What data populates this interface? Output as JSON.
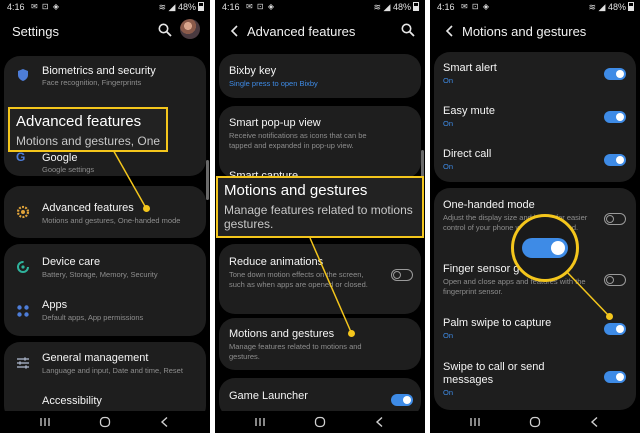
{
  "status": {
    "time": "4:16",
    "battery": "48%"
  },
  "screen1": {
    "title": "Settings",
    "items": [
      {
        "title": "Biometrics and security",
        "sub": "Face recognition, Fingerprints"
      },
      {
        "title": "Google",
        "sub": "Google settings"
      },
      {
        "title": "Advanced features",
        "sub": "Motions and gestures, One-handed mode"
      },
      {
        "title": "Device care",
        "sub": "Battery, Storage, Memory, Security"
      },
      {
        "title": "Apps",
        "sub": "Default apps, App permissions"
      },
      {
        "title": "General management",
        "sub": "Language and input, Date and time, Reset"
      },
      {
        "title": "Accessibility",
        "sub": ""
      }
    ],
    "callout": {
      "title": "Advanced features",
      "sub": "Motions and gestures, One"
    }
  },
  "screen2": {
    "title": "Advanced features",
    "items": [
      {
        "title": "Bixby key",
        "sub": "Single press to open Bixby"
      },
      {
        "title": "Smart pop-up view",
        "sub": "Receive notifications as icons that can be tapped and expanded in pop-up view."
      },
      {
        "title": "Smart capture",
        "sub": ""
      },
      {
        "title": "Reduce animations",
        "sub": "Tone down motion effects on the screen, such as when apps are opened or closed."
      },
      {
        "title": "Motions and gestures",
        "sub": "Manage features related to motions and gestures."
      },
      {
        "title": "Game Launcher",
        "sub": ""
      }
    ],
    "callout": {
      "title": "Motions and gestures",
      "sub": "Manage features related to motions gestures."
    }
  },
  "screen3": {
    "title": "Motions and gestures",
    "items": [
      {
        "title": "Smart alert",
        "sub": "On"
      },
      {
        "title": "Easy mute",
        "sub": "On"
      },
      {
        "title": "Direct call",
        "sub": "On"
      },
      {
        "title": "One-handed mode",
        "sub": "Adjust the display size and layout for easier control of your phone with just one hand."
      },
      {
        "title": "Finger sensor gestures",
        "sub": "Open and close apps and features with the fingerprint sensor."
      },
      {
        "title": "Palm swipe to capture",
        "sub": "On"
      },
      {
        "title": "Swipe to call or send messages",
        "sub": "On"
      }
    ]
  },
  "colors": {
    "accent": "#3e8be6",
    "highlight": "#f4c61c",
    "card": "#1e1e1e"
  }
}
